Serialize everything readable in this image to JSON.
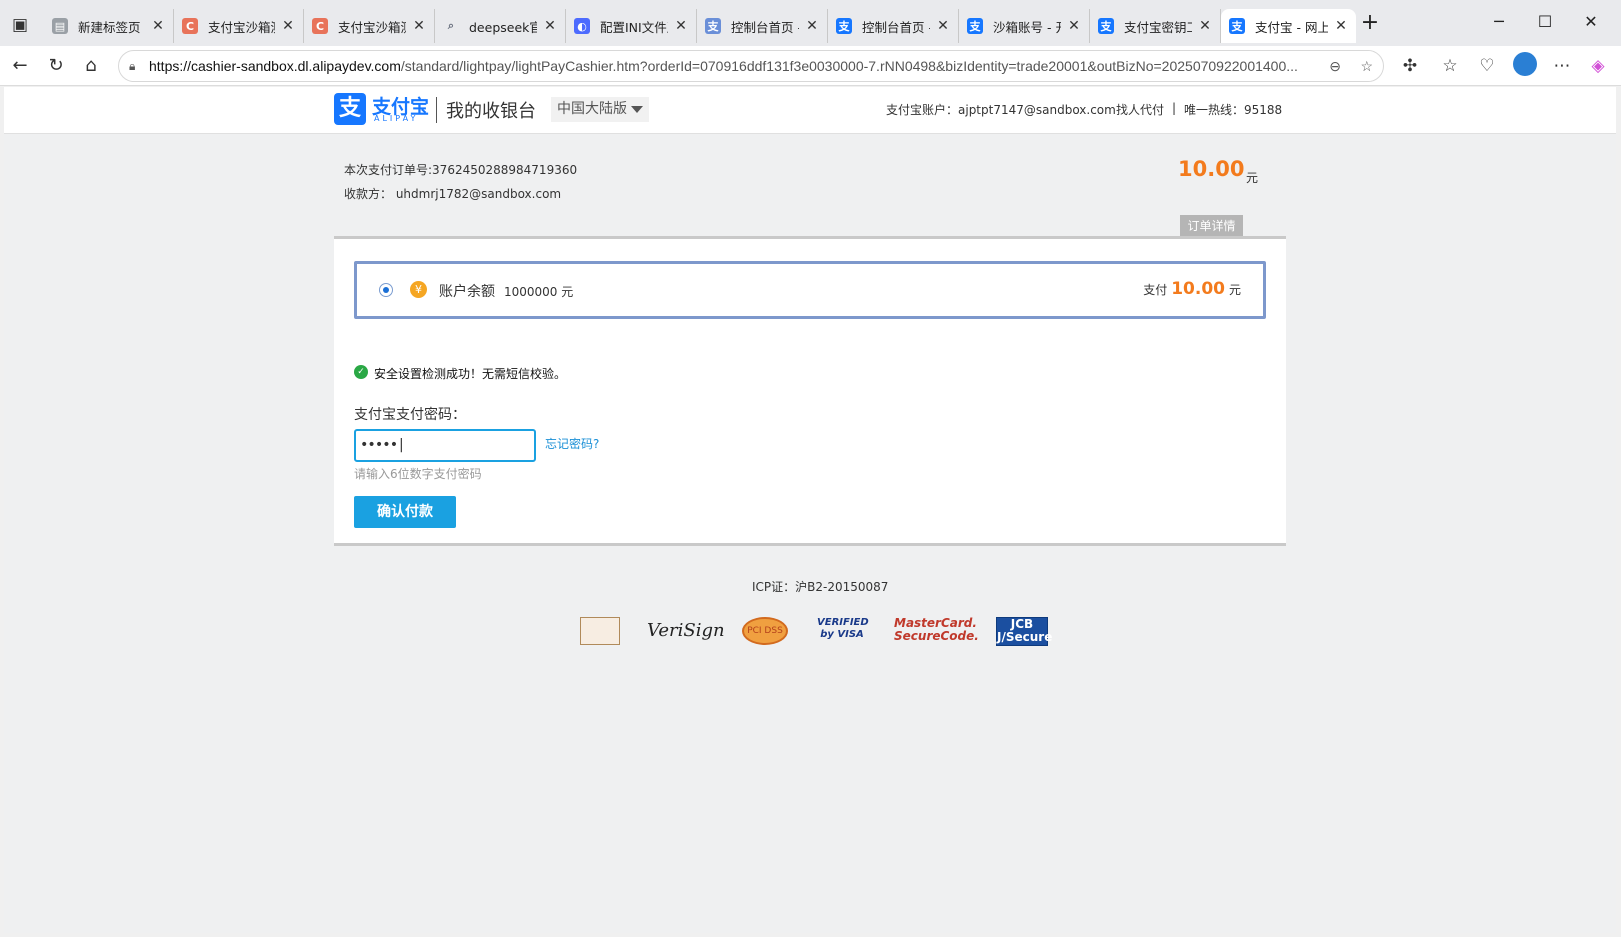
{
  "browser": {
    "tabs": [
      {
        "title": "新建标签页",
        "icon": "new-tab-icon",
        "color": "#9aa0a6"
      },
      {
        "title": "支付宝沙箱测试",
        "icon": "c-icon",
        "color": "#e8735a"
      },
      {
        "title": "支付宝沙箱测试",
        "icon": "c-icon",
        "color": "#e8735a"
      },
      {
        "title": "deepseek官网",
        "icon": "search-icon",
        "color": "#6b7280"
      },
      {
        "title": "配置INI文件及",
        "icon": "deepseek-icon",
        "color": "#4d6bfe"
      },
      {
        "title": "控制台首页 - 支",
        "icon": "alipay-icon",
        "color": "#6a8fd8"
      },
      {
        "title": "控制台首页 - 支",
        "icon": "alipay-icon",
        "color": "#1677ff"
      },
      {
        "title": "沙箱账号 - 开放",
        "icon": "alipay-icon",
        "color": "#1677ff"
      },
      {
        "title": "支付宝密钥工具",
        "icon": "alipay-icon",
        "color": "#1677ff"
      },
      {
        "title": "支付宝 - 网上",
        "icon": "alipay-icon",
        "color": "#1677ff"
      }
    ],
    "url_host": "https://cashier-sandbox.dl.alipaydev.com",
    "url_rest": "/standard/lightpay/lightPayCashier.htm?orderId=070916ddf131f3e0030000-7.rNN0498&bizIdentity=trade20001&outBizNo=2025070922001400..."
  },
  "header": {
    "logo_mark": "支",
    "logo_cn": "支付宝",
    "logo_en": "ALIPAY",
    "title": "我的收银台",
    "region": "中国大陆版",
    "account": "支付宝账户：ajptpt7147@sandbox.com",
    "proxy": "找人代付",
    "hotline": "唯一热线：95188"
  },
  "order": {
    "order_no": "本次支付订单号:3762450288984719360",
    "payee": "收款方： uhdmrj1782@sandbox.com",
    "amount": "10.00",
    "unit": "元",
    "detail_tab": "订单详情"
  },
  "method": {
    "label": "账户余额",
    "balance": "1000000 元",
    "pay_prefix": "支付",
    "pay_amount": "10.00",
    "pay_unit": "元"
  },
  "security": {
    "check_text": "安全设置检测成功！无需短信校验。",
    "pwd_label": "支付宝支付密码：",
    "pwd_value": "•••••|",
    "forgot": "忘记密码?",
    "hint": "请输入6位数字支付密码",
    "submit": "确认付款"
  },
  "footer": {
    "icp": "ICP证：沪B2-20150087",
    "badges": [
      "VeriSign",
      "VERIFIED by VISA",
      "MasterCard. SecureCode.",
      "JCB J/Secure"
    ]
  },
  "colors": {
    "brand": "#1677ff",
    "amount": "#f37b1d",
    "button": "#1aa1e1",
    "success": "#2aa845"
  }
}
